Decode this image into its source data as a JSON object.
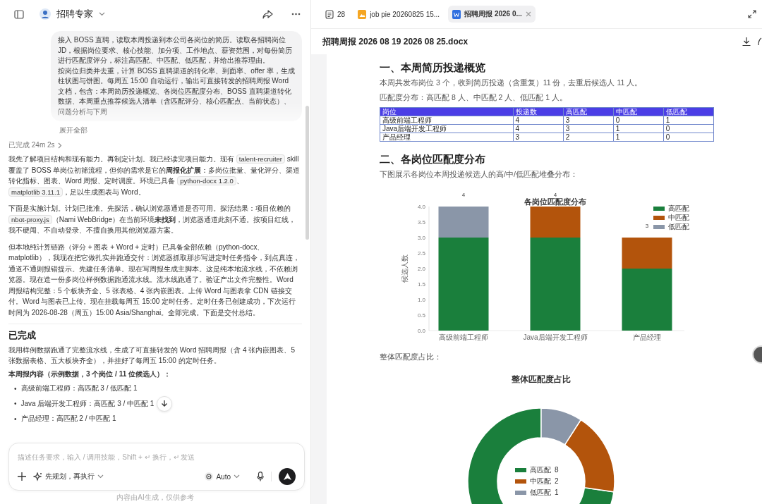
{
  "chat_header": {
    "title": "招聘专家"
  },
  "user_message": {
    "paragraphs": [
      "接入 BOSS 直聘，读取本周投递到本公司各岗位的简历。读取各招聘岗位 JD，根据岗位要求、核心技能、加分项、工作地点、薪资范围，对每份简历进行匹配度评分，标注高匹配、中匹配、低匹配，并给出推荐理由。",
      "按岗位归类并去重，计算 BOSS 直聘渠道的转化率、到面率、offer 率，生成柱状图与饼图。每周五 15:00 自动运行，输出可直接转发的招聘周报 Word 文档，包含：本周简历投递概览、各岗位匹配度分布、BOSS 直聘渠道转化数据、本周重点推荐候选人清单（含匹配评分、核心匹配点、当前状态）、问题分析与下周"
    ],
    "expand_link": "展开全部"
  },
  "status": {
    "text": "已完成 24m 2s"
  },
  "reply": {
    "paragraphs": [
      [
        {
          "kind": "text",
          "text": "我先了解项目结构和现有能力。再制定计划。我已经读完项目能力。现有 "
        },
        {
          "kind": "code",
          "text": "talent-recruiter"
        },
        {
          "kind": "text",
          "text": " skill 覆盖了 BOSS 单岗位初筛流程，但你的需求是它的**周报化扩展**：多岗位批量、量化评分、渠道转化指标、图表、Word 周报、定时调度。环境已具备 "
        },
        {
          "kind": "code",
          "text": "python-docx 1.2.0"
        },
        {
          "kind": "text",
          "text": "、"
        },
        {
          "kind": "code",
          "text": "matplotlib 3.11.1"
        },
        {
          "kind": "text",
          "text": "，足以生成图表与 Word。"
        }
      ],
      [
        {
          "kind": "text",
          "text": "下面是实施计划。计划已批准。先探活，确认浏览器通道是否可用。探活结果：项目依赖的 "
        },
        {
          "kind": "code",
          "text": "nbot-proxy.js"
        },
        {
          "kind": "text",
          "text": "（Nami WebBridge）在当前环境**未找到**，浏览器通道此刻不通。按项目红线，我不硬闯、不自动登录、不擅自换用其他浏览器方案。"
        }
      ],
      [
        {
          "kind": "text",
          "text": "但本地纯计算链路（评分 + 图表 + Word + 定时）已具备全部依赖（python-docx、matplotlib），我现在把它做扎实并跑通交付：浏览器抓取那步写进定时任务指令，到点真连，通道不通则报错提示。先建任务清单。现在写周报生成主脚本。这是纯本地流水线，不依赖浏览器。现在造一份多岗位样例数据跑通流水线。流水线跑通了。验证产出文件完整性。Word 周报结构完整：5 个板块齐全、5 张表格、4 张内嵌图表。上传 Word 与图表拿 CDN 链接交付。Word 与图表已上传。现在挂载每周五 15:00 定时任务。定时任务已创建成功，下次运行时间为 2026-08-28（周五）15:00 Asia/Shanghai。全部完成。下面是交付总结。"
        }
      ]
    ]
  },
  "summary": {
    "heading": "已完成",
    "blocks": [
      {
        "kind": "paragraph",
        "text": "我用样例数据跑通了完整流水线，生成了可直接转发的 Word 招聘周报（含 4 张内嵌图表、5 张数据表格、五大板块齐全），并挂好了每周五 15:00 的定时任务。"
      },
      {
        "kind": "lead",
        "text": "本周报内容（示例数据，3 个岗位 / 11 位候选人）："
      }
    ],
    "bullets": [
      {
        "marker": "•",
        "text": "高级前端工程师：高匹配 3 / 低匹配 1"
      },
      {
        "marker": "•",
        "text": "Java 后端开发工程师：高匹配 3 / 中匹配 1"
      },
      {
        "marker": "•",
        "text": "产品经理：高匹配 2 / 中匹配 1"
      }
    ]
  },
  "composer": {
    "placeholder": "描述任务要求，输入 / 调用技能，Shift + ↵ 换行，↵ 发送",
    "mode": "先规划，再执行",
    "model": "Auto"
  },
  "footer_note": "内容由AI生成，仅供参考",
  "tabs": [
    {
      "kind": "count",
      "label": "28",
      "selected": false
    },
    {
      "kind": "image",
      "label": "job pie 20260825 15...",
      "selected": false
    },
    {
      "kind": "word",
      "label": "招聘周报 2026 0...",
      "selected": true
    }
  ],
  "document": {
    "file_name": "招聘周报 2026 08 19 2026 08 25.docx",
    "sections": [
      {
        "heading": "一、本周简历投递概览",
        "paragraphs": [
          "本周共发布岗位 3 个，收到简历投递（含重复）11 份，去重后候选人 11 人。",
          "匹配度分布：高匹配 8 人、中匹配 2 人、低匹配 1 人。"
        ],
        "table": {
          "columns": [
            "岗位",
            "投递数",
            "高匹配",
            "中匹配",
            "低匹配"
          ],
          "rows": [
            [
              "高级前端工程师",
              "4",
              "3",
              "0",
              "1"
            ],
            [
              "Java后端开发工程师",
              "4",
              "3",
              "1",
              "0"
            ],
            [
              "产品经理",
              "3",
              "2",
              "1",
              "0"
            ]
          ]
        }
      },
      {
        "heading": "二、各岗位匹配度分布",
        "paragraphs": [
          "下图展示各岗位本周投递候选人的高/中/低匹配堆叠分布："
        ],
        "chart_data": {
          "type": "bar",
          "title": "各岗位匹配度分布",
          "ylabel": "候选人数",
          "categories": [
            "高级前端工程师",
            "Java后端开发工程师",
            "产品经理"
          ],
          "stacked": true,
          "ylim": [
            0,
            4
          ],
          "yticks": [
            {
              "value": 0,
              "label": "0.0"
            },
            {
              "value": 0.5,
              "label": "0.5"
            },
            {
              "value": 1,
              "label": "1.0"
            },
            {
              "value": 1.5,
              "label": "1.5"
            },
            {
              "value": 2,
              "label": "2.0"
            },
            {
              "value": 2.5,
              "label": "2.5"
            },
            {
              "value": 3,
              "label": "3.0"
            },
            {
              "value": 3.5,
              "label": "3.5"
            },
            {
              "value": 4,
              "label": "4.0"
            }
          ],
          "series": [
            {
              "name": "高匹配",
              "color": "#1a7f3c",
              "values": [
                3,
                3,
                2
              ]
            },
            {
              "name": "中匹配",
              "color": "#b3540c",
              "values": [
                0,
                1,
                1
              ]
            },
            {
              "name": "低匹配",
              "color": "#8a96a8",
              "values": [
                1,
                0,
                0
              ]
            }
          ],
          "value_labels": [
            "4",
            "4",
            "3"
          ],
          "legend": true
        }
      },
      {
        "paragraphs": [
          "整体匹配度占比："
        ],
        "chart_data": {
          "type": "donut",
          "title": "整体匹配度占比",
          "categories": [
            "高匹配",
            "中匹配",
            "低匹配"
          ],
          "values": [
            8,
            2,
            1
          ],
          "value_labels": [
            "8",
            "2",
            "1"
          ],
          "colors": [
            "#1a7f3c",
            "#b3540c",
            "#8a96a8"
          ],
          "legend": true
        }
      }
    ]
  }
}
